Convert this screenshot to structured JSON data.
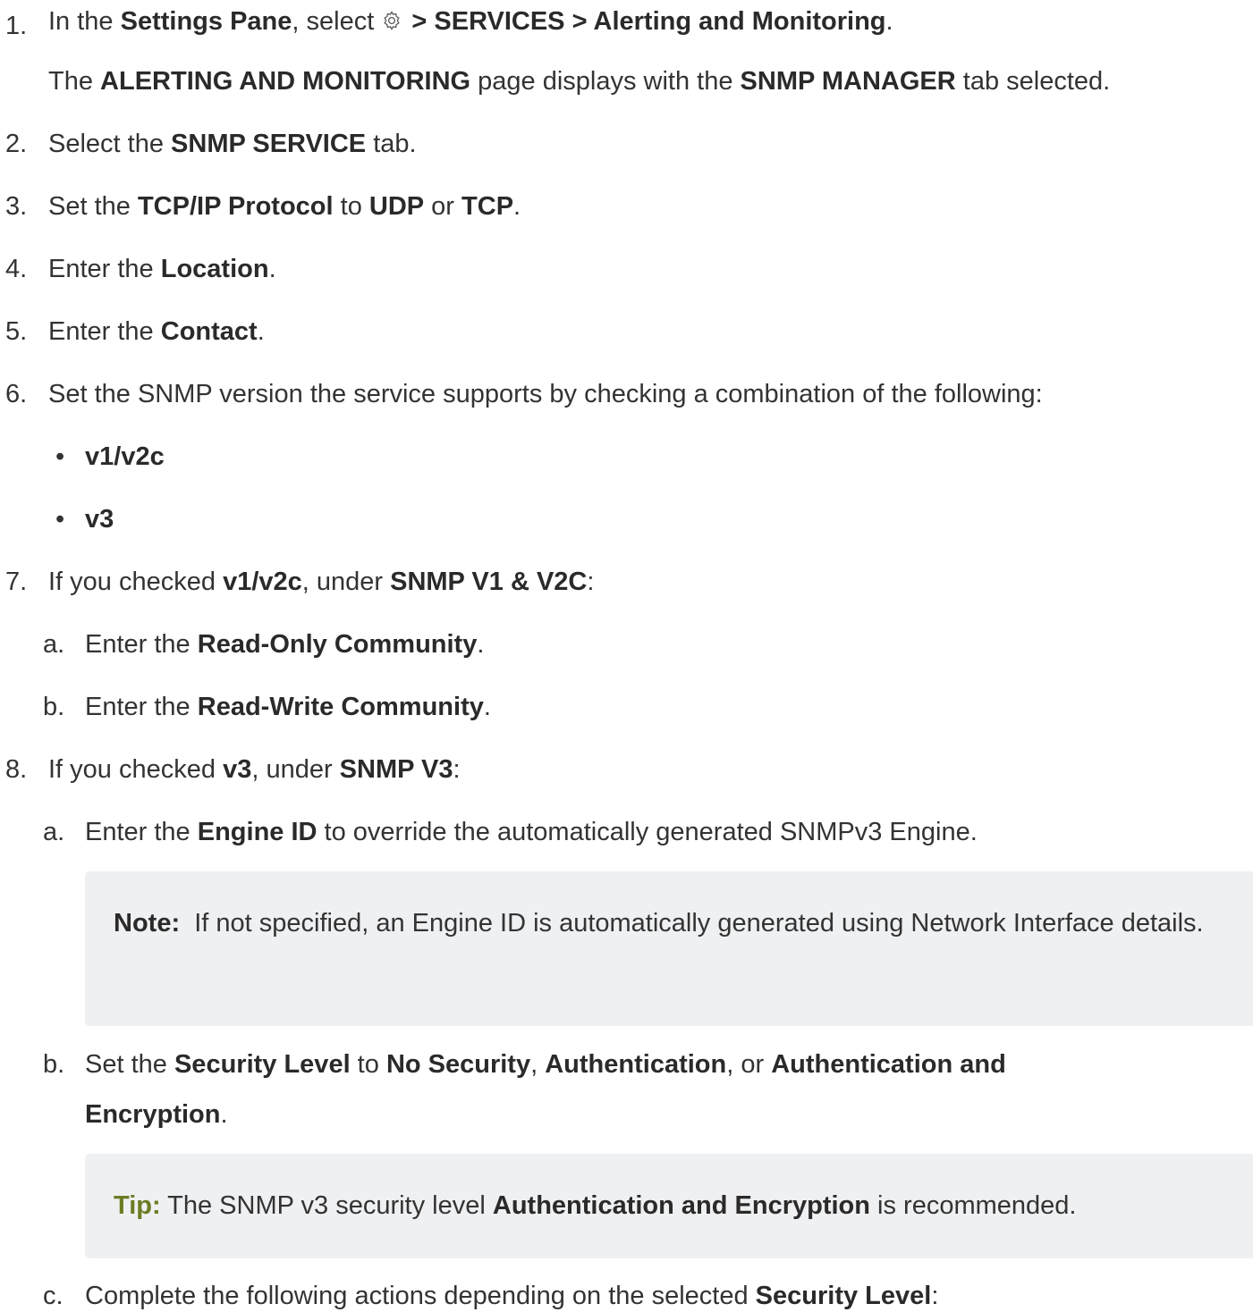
{
  "steps": {
    "s1": {
      "num": "1.",
      "t1": "In the ",
      "b1": "Settings Pane",
      "t2": ", select ",
      "icon": "gear-icon",
      "b2": " > SERVICES > Alerting and Monitoring",
      "t3": ".",
      "p2_t1": "The ",
      "p2_b1": "ALERTING AND MONITORING",
      "p2_t2": " page displays with the ",
      "p2_b2": "SNMP MANAGER",
      "p2_t3": " tab selected."
    },
    "s2": {
      "num": "2.",
      "t1": "Select the ",
      "b1": "SNMP SERVICE",
      "t2": " tab."
    },
    "s3": {
      "num": "3.",
      "t1": "Set the ",
      "b1": "TCP/IP Protocol",
      "t2": " to ",
      "b2": "UDP",
      "t3": " or ",
      "b3": "TCP",
      "t4": "."
    },
    "s4": {
      "num": "4.",
      "t1": "Enter the ",
      "b1": "Location",
      "t2": "."
    },
    "s5": {
      "num": "5.",
      "t1": "Enter the ",
      "b1": "Contact",
      "t2": "."
    },
    "s6": {
      "num": "6.",
      "t1": "Set the SNMP version the service supports by checking a combination of the following:",
      "bullets": [
        "v1/v2c",
        "v3"
      ],
      "bullet_char": "•"
    },
    "s7": {
      "num": "7.",
      "t1": "If you checked ",
      "b1": "v1/v2c",
      "t2": ", under ",
      "b2": "SNMP V1 & V2C",
      "t3": ":",
      "a": {
        "num": "a.",
        "t1": "Enter the ",
        "b1": "Read-Only Community",
        "t2": "."
      },
      "b": {
        "num": "b.",
        "t1": "Enter the ",
        "b1": "Read-Write Community",
        "t2": "."
      }
    },
    "s8": {
      "num": "8.",
      "t1": "If you checked ",
      "b1": "v3",
      "t2": ", under ",
      "b2": "SNMP V3",
      "t3": ":",
      "a": {
        "num": "a.",
        "t1": "Enter the ",
        "b1": "Engine ID",
        "t2": " to override the automatically generated SNMPv3 Engine."
      },
      "note": {
        "label": "Note:",
        "text": "  If not specified, an Engine ID is automatically generated using Network Interface details."
      },
      "b": {
        "num": "b.",
        "t1": "Set the ",
        "b1": "Security Level",
        "t2": " to ",
        "b2": "No Security",
        "t3": ", ",
        "b3": "Authentication",
        "t4": ", or ",
        "b4": "Authentication and",
        "b5": "Encryption",
        "t5": "."
      },
      "tip": {
        "label": "Tip:",
        "t1": " The SNMP v3 security level ",
        "b1": "Authentication and Encryption",
        "t2": " is recommended."
      },
      "c": {
        "num": "c.",
        "t1": "Complete the following actions depending on the selected ",
        "b1": "Security Level",
        "t2": ":"
      }
    }
  },
  "colors": {
    "text": "#333333",
    "callout_bg": "#eff0f2",
    "tip_label": "#6b7c23"
  }
}
